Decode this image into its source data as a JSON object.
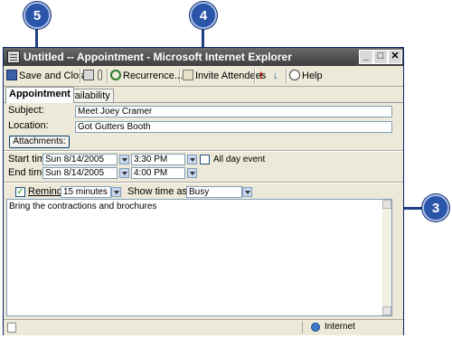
{
  "callouts": {
    "step5": "5",
    "step4": "4",
    "step3": "3"
  },
  "window": {
    "title": "Untitled -- Appointment - Microsoft Internet Explorer",
    "minimize": "_",
    "maximize": "□",
    "close": "✕"
  },
  "toolbar": {
    "save_close": "Save and Close",
    "recurrence": "Recurrence...",
    "invite": "Invite Attendees",
    "help": "Help"
  },
  "tabs": {
    "appointment": "Appointment",
    "availability": "Availability"
  },
  "form": {
    "subject_label": "Subject:",
    "subject_value": "Meet Joey Cramer",
    "location_label": "Location:",
    "location_value": "Got Gutters Booth",
    "attachments_label": "Attachments:",
    "start_label": "Start time:",
    "start_date": "Sun 8/14/2005",
    "start_time": "3:30 PM",
    "end_label": "End time:",
    "end_date": "Sun 8/14/2005",
    "end_time": "4:00 PM",
    "all_day_label": "All day event",
    "reminder_label": "Reminder:",
    "reminder_value": "15 minutes",
    "show_time_label": "Show time as:",
    "show_time_value": "Busy",
    "notes": "Bring the contractions and brochures"
  },
  "status": {
    "zone": "Internet"
  },
  "colors": {
    "callout": "#2b55a8",
    "callout_line": "#1f3f86",
    "highlight": "#2b55a8"
  }
}
